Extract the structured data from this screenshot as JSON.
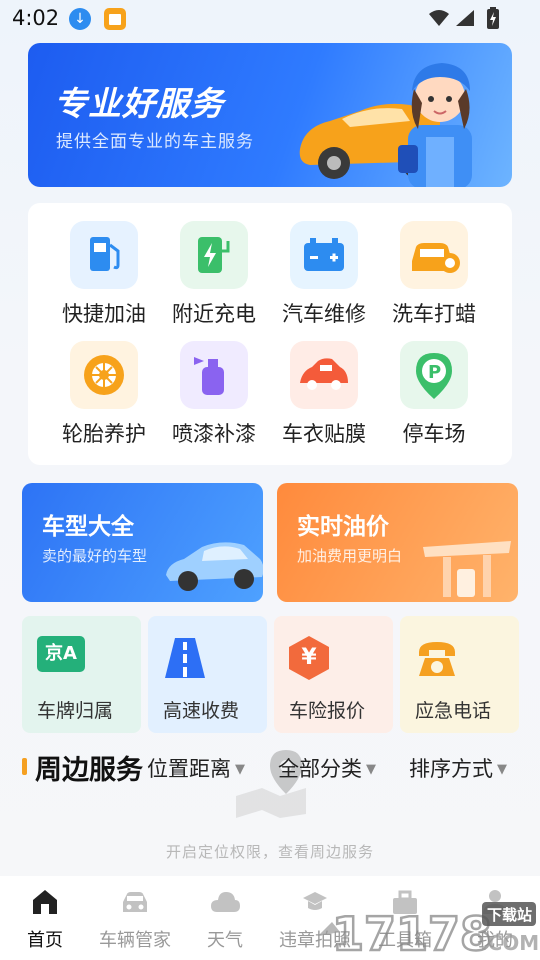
{
  "status_bar": {
    "time": "4:02"
  },
  "banner": {
    "title": "专业好服务",
    "subtitle": "提供全面专业的车主服务"
  },
  "services": [
    {
      "label": "快捷加油",
      "icon": "fuel-pump-icon",
      "color": "#2d8cf0",
      "bg": "#e6f2ff"
    },
    {
      "label": "附近充电",
      "icon": "charging-station-icon",
      "color": "#3bbf6a",
      "bg": "#e7f7ec"
    },
    {
      "label": "汽车维修",
      "icon": "car-battery-icon",
      "color": "#2d8cf0",
      "bg": "#e6f4ff"
    },
    {
      "label": "洗车打蜡",
      "icon": "car-wash-icon",
      "color": "#f7a21b",
      "bg": "#fff3e0"
    },
    {
      "label": "轮胎养护",
      "icon": "tire-icon",
      "color": "#f7a21b",
      "bg": "#fff3e0"
    },
    {
      "label": "喷漆补漆",
      "icon": "spray-paint-icon",
      "color": "#8a63f0",
      "bg": "#f0ebff"
    },
    {
      "label": "车衣贴膜",
      "icon": "car-cover-icon",
      "color": "#f45b3a",
      "bg": "#ffece6"
    },
    {
      "label": "停车场",
      "icon": "parking-location-icon",
      "color": "#3bbf6a",
      "bg": "#e7f7ec"
    }
  ],
  "promos": [
    {
      "title": "车型大全",
      "subtitle": "卖的最好的车型"
    },
    {
      "title": "实时油价",
      "subtitle": "加油费用更明白"
    }
  ],
  "tools": [
    {
      "label": "车牌归属",
      "badge": "京A",
      "icon": "license-plate-icon"
    },
    {
      "label": "高速收费",
      "icon": "highway-icon"
    },
    {
      "label": "车险报价",
      "badge": "¥",
      "icon": "insurance-price-icon"
    },
    {
      "label": "应急电话",
      "icon": "telephone-icon"
    }
  ],
  "nearby": {
    "title": "周边服务",
    "filters": [
      "位置距离",
      "全部分类",
      "排序方式"
    ],
    "empty_text": "开启定位权限，查看周边服务"
  },
  "bottom_nav": [
    {
      "label": "首页",
      "icon": "home-icon",
      "active": true
    },
    {
      "label": "车辆管家",
      "icon": "car-icon",
      "active": false
    },
    {
      "label": "天气",
      "icon": "cloud-icon",
      "active": false
    },
    {
      "label": "违章拍照",
      "icon": "camera-icon",
      "active": false
    },
    {
      "label": "工具箱",
      "icon": "toolbox-icon",
      "active": false
    },
    {
      "label": "我的",
      "icon": "user-icon",
      "active": false
    }
  ],
  "watermark": {
    "text": "17178",
    "suffix": ".COM",
    "tag": "下载站"
  },
  "colors": {
    "primary": "#2d6ff5",
    "accent_orange": "#f5a021"
  }
}
